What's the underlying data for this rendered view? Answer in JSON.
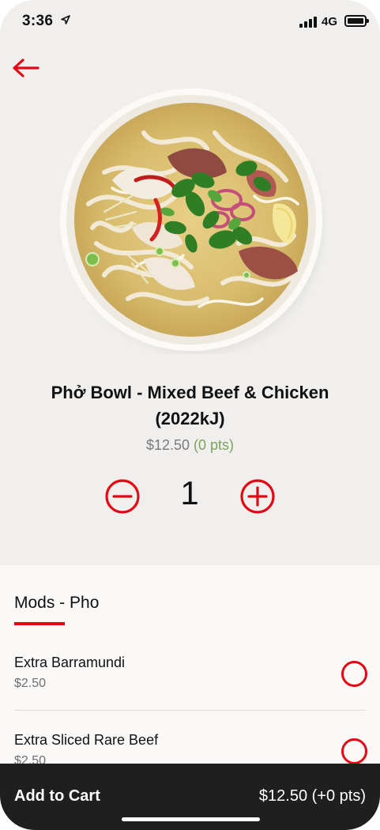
{
  "status_bar": {
    "time": "3:36",
    "network": "4G",
    "icons": [
      "location-arrow-icon",
      "signal-icon",
      "battery-icon"
    ]
  },
  "nav": {
    "back_icon": "arrow-left-icon"
  },
  "product": {
    "image": "pho-bowl-image",
    "name": "Phở Bowl - Mixed Beef & Chicken (2022kJ)",
    "price": "$12.50",
    "points": "(0 pts)"
  },
  "quantity": {
    "value": "1",
    "minus_icon": "minus-circle-icon",
    "plus_icon": "plus-circle-icon"
  },
  "mods": {
    "title": "Mods - Pho",
    "items": [
      {
        "name": "Extra Barramundi",
        "price": "$2.50",
        "selected": false
      },
      {
        "name": "Extra Sliced Rare Beef",
        "price": "$2.50",
        "selected": false
      }
    ]
  },
  "cart": {
    "label": "Add to Cart",
    "total": "$12.50 (+0 pts)"
  },
  "colors": {
    "accent": "#e30613",
    "background": "#f0efed",
    "panel": "#faf9f7",
    "cart_bar": "#1f1f1f",
    "points_green": "#7aa35c",
    "muted_text": "#7a7a7a"
  }
}
